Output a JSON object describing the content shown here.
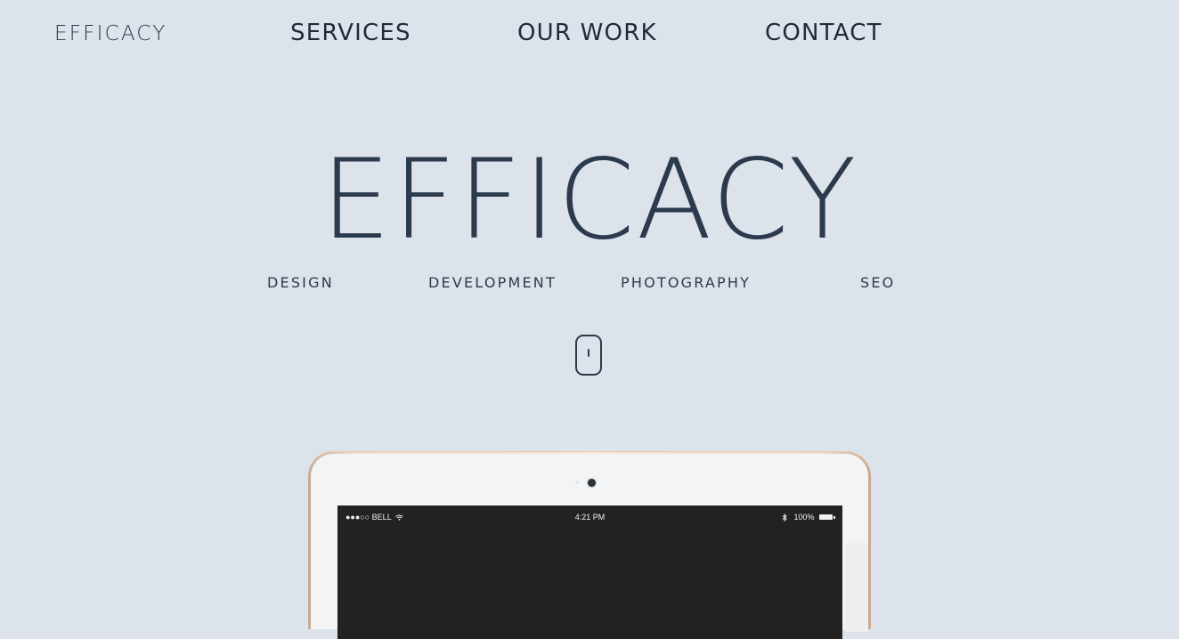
{
  "nav": {
    "logo": "EFFICACY",
    "links": [
      "SERVICES",
      "OUR WORK",
      "CONTACT"
    ]
  },
  "hero": {
    "title": "EFFICACY",
    "services": [
      "DESIGN",
      "DEVELOPMENT",
      "PHOTOGRAPHY",
      "SEO"
    ]
  },
  "device": {
    "status_bar": {
      "carrier": "●●●○○ BELL",
      "wifi_icon": "⌑",
      "time": "4:21 PM",
      "bluetooth_icon": "ᚼ",
      "battery": "100%"
    }
  },
  "colors": {
    "background": "#dce3eb",
    "text": "#2c3a4d",
    "screen": "#232220"
  }
}
